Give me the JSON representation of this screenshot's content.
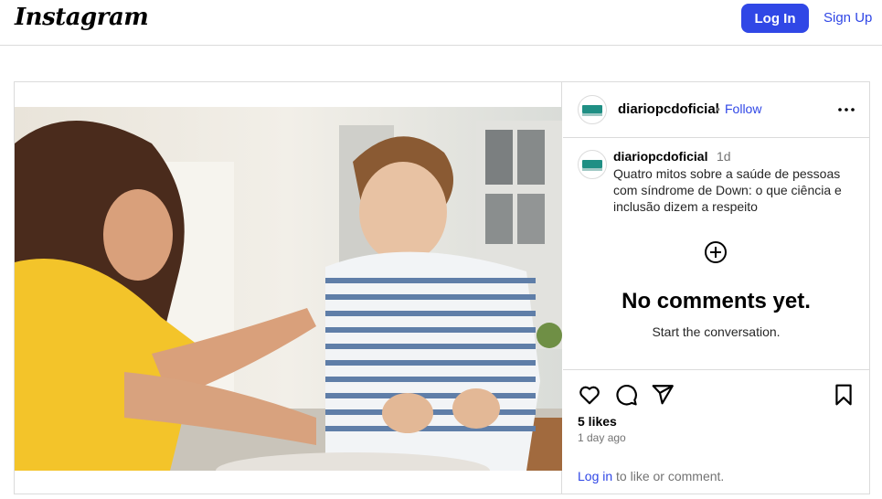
{
  "header": {
    "logo_text": "Instagram",
    "login_label": "Log In",
    "signup_label": "Sign Up"
  },
  "post": {
    "username": "diariopcdoficial",
    "separator": "•",
    "follow_label": "Follow",
    "caption": {
      "username": "diariopcdoficial",
      "time": "1d",
      "text": "Quatro mitos sobre a saúde de pessoas com síndrome de Down: o que ciência e inclusão dizem a respeito"
    },
    "comments_empty_title": "No comments yet.",
    "comments_empty_subtitle": "Start the conversation.",
    "likes": "5 likes",
    "time_ago": "1 day ago",
    "login_prompt_link": "Log in",
    "login_prompt_rest": " to like or comment."
  },
  "icons": {
    "more": "more-options-icon",
    "add_comment": "add-circle-icon",
    "like": "heart-icon",
    "comment": "comment-icon",
    "share": "share-icon",
    "save": "bookmark-icon"
  },
  "colors": {
    "accent": "#3047e6",
    "border": "#dbdbdb",
    "muted": "#737373"
  }
}
